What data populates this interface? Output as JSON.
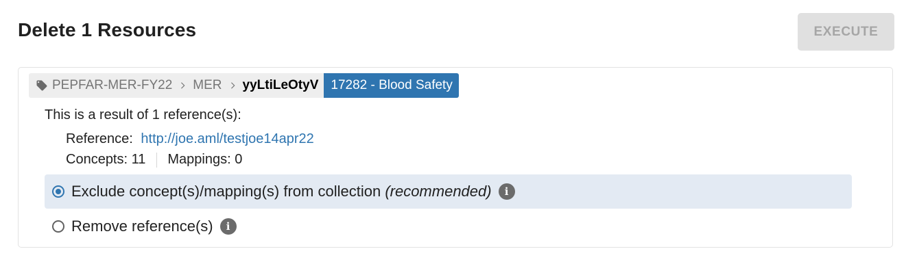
{
  "header": {
    "title": "Delete 1 Resources",
    "execute_label": "EXECUTE"
  },
  "breadcrumb": {
    "icon": "tag-icon",
    "source": "PEPFAR-MER-FY22",
    "separator_icon": "chevron-right-icon",
    "owner": "MER",
    "code": "yyLtiLeOtyV",
    "name": "17282 - Blood Safety"
  },
  "result": {
    "text": "This is a result of 1 reference(s):",
    "reference_label": "Reference:",
    "reference_url": "http://joe.aml/testjoe14apr22",
    "concepts_label": "Concepts:",
    "concepts_count": "11",
    "mappings_label": "Mappings:",
    "mappings_count": "0"
  },
  "options": [
    {
      "label": "Exclude concept(s)/mapping(s) from collection",
      "note": "(recommended)",
      "selected": true,
      "icon": "info-icon"
    },
    {
      "label": "Remove reference(s)",
      "note": "",
      "selected": false,
      "icon": "info-icon"
    }
  ],
  "colors": {
    "primary": "#2f75b0",
    "selected_bg": "#e3eaf3",
    "disabled_button_bg": "#e0e0e0",
    "disabled_button_text": "#a6a6a6",
    "crumb_bg": "#eeeeee"
  }
}
